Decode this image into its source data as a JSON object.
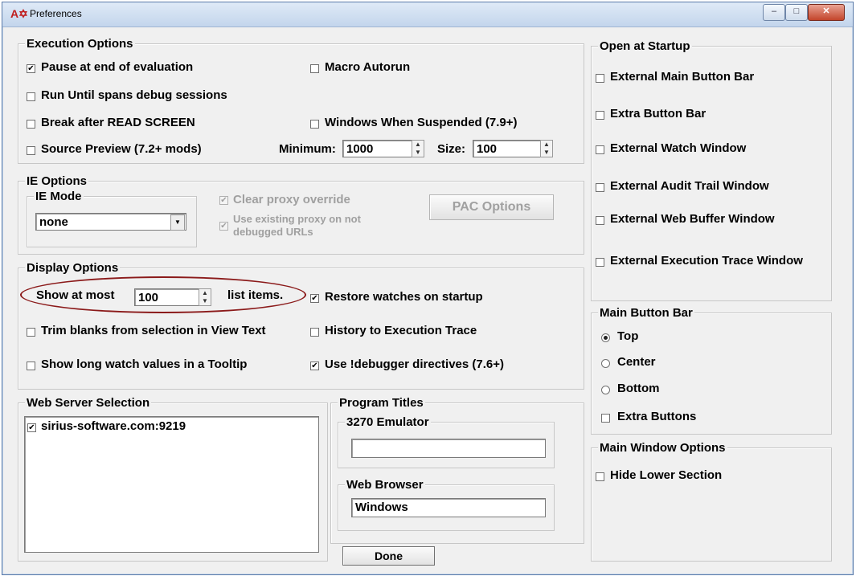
{
  "window": {
    "title": "Preferences",
    "icon": "app-icon",
    "minimize": "–",
    "maximize": "□",
    "close": "✕"
  },
  "execution": {
    "legend": "Execution Options",
    "pause": {
      "label": "Pause at end of evaluation",
      "checked": true
    },
    "macro": {
      "label": "Macro Autorun",
      "checked": false
    },
    "rununtil": {
      "label": "Run Until spans debug sessions",
      "checked": false
    },
    "breakafter": {
      "label": "Break after READ SCREEN",
      "checked": false
    },
    "winsusp": {
      "label": "Windows When Suspended (7.9+)",
      "checked": false
    },
    "srcprev": {
      "label": "Source Preview (7.2+ mods)",
      "checked": false
    },
    "minimum_label": "Minimum:",
    "minimum_value": "1000",
    "size_label": "Size:",
    "size_value": "100"
  },
  "ie": {
    "legend": "IE Options",
    "mode_legend": "IE Mode",
    "mode_value": "none",
    "clear_proxy": {
      "label": "Clear proxy override",
      "checked": true
    },
    "use_proxy_1": "Use existing proxy on not",
    "use_proxy_2": "debugged URLs",
    "pac_button": "PAC Options"
  },
  "display": {
    "legend": "Display Options",
    "show_at_most": "Show at most",
    "show_value": "100",
    "list_items": "list items.",
    "restore": {
      "label": "Restore watches on startup",
      "checked": true
    },
    "trim": {
      "label": "Trim blanks from selection in View Text",
      "checked": false
    },
    "history": {
      "label": "History to Execution Trace",
      "checked": false
    },
    "tooltip": {
      "label": "Show long watch values in a Tooltip",
      "checked": false
    },
    "directives": {
      "label": "Use !debugger directives (7.6+)",
      "checked": true
    }
  },
  "webserver": {
    "legend": "Web Server Selection",
    "items": [
      {
        "label": "sirius-software.com:9219",
        "checked": true
      }
    ]
  },
  "titles": {
    "legend": "Program Titles",
    "emulator_legend": "3270 Emulator",
    "emulator_value": "",
    "browser_legend": "Web Browser",
    "browser_value": "Windows"
  },
  "startup": {
    "legend": "Open at Startup",
    "items": [
      {
        "label": "External Main Button Bar",
        "checked": false
      },
      {
        "label": "Extra Button Bar",
        "checked": false
      },
      {
        "label": "External Watch Window",
        "checked": false
      },
      {
        "label": "External Audit Trail Window",
        "checked": false
      },
      {
        "label": "External Web Buffer Window",
        "checked": false
      },
      {
        "label": "External Execution Trace Window",
        "checked": false
      }
    ]
  },
  "mainbar": {
    "legend": "Main Button Bar",
    "top": "Top",
    "center": "Center",
    "bottom": "Bottom",
    "selected": "Top",
    "extra": {
      "label": "Extra Buttons",
      "checked": false
    }
  },
  "mainwin": {
    "legend": "Main Window Options",
    "hide": {
      "label": "Hide Lower Section",
      "checked": false
    }
  },
  "done": "Done",
  "colors": {
    "highlight_oval": "#8b1a1a",
    "dialog_bg": "#f0f0f0",
    "close_button": "#c3452b"
  }
}
